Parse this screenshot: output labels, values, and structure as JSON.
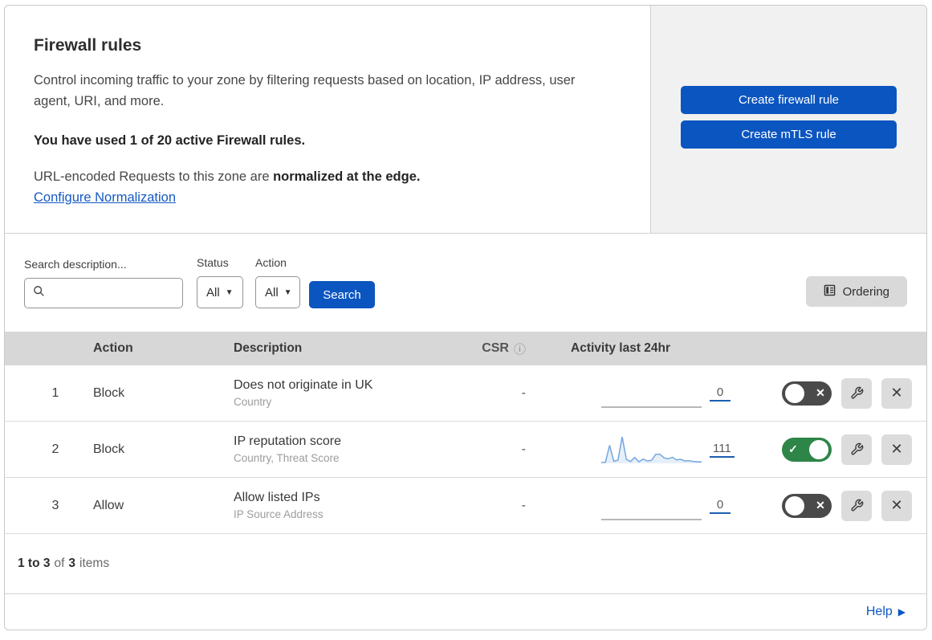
{
  "colors": {
    "accent_blue": "#0b55c0",
    "link_blue": "#1459c4",
    "toggle_on_green": "#2e8548",
    "toggle_off_gray": "#4a4a4a",
    "panel_gray": "#f1f1f1",
    "table_header_gray": "#d7d7d7",
    "icon_button_gray": "#dcdcdc",
    "sparkline_blue": "#74a7dd"
  },
  "header": {
    "title": "Firewall rules",
    "description": "Control incoming traffic to your zone by filtering requests based on location, IP address, user agent, URI, and more.",
    "usage_bold": "You have used 1 of 20 active Firewall rules.",
    "normalization_prefix": "URL-encoded Requests to this zone are ",
    "normalization_bold": "normalized at the edge.",
    "normalization_link": "Configure Normalization",
    "create_firewall_button": "Create firewall rule",
    "create_mtls_button": "Create mTLS rule"
  },
  "filters": {
    "search_label": "Search description...",
    "status_label": "Status",
    "status_value": "All",
    "action_label": "Action",
    "action_value": "All",
    "search_button": "Search",
    "ordering_button": "Ordering"
  },
  "table": {
    "columns": {
      "action": "Action",
      "description": "Description",
      "csr": "CSR",
      "activity": "Activity last 24hr"
    },
    "rows": [
      {
        "priority": "1",
        "action": "Block",
        "description": "Does not originate in UK",
        "fields": "Country",
        "csr": "-",
        "activity_count": "0",
        "enabled": false,
        "sparkline": []
      },
      {
        "priority": "2",
        "action": "Block",
        "description": "IP reputation score",
        "fields": "Country, Threat Score",
        "csr": "-",
        "activity_count": "111",
        "enabled": true,
        "sparkline": [
          0.3,
          0.4,
          6.8,
          0.8,
          1.2,
          10,
          1.5,
          0.7,
          2.2,
          0.6,
          1.6,
          0.9,
          1.1,
          3.4,
          3.5,
          2.1,
          1.7,
          2.3,
          1.3,
          1.5,
          0.9,
          1.0,
          0.7,
          0.6,
          0.5
        ]
      },
      {
        "priority": "3",
        "action": "Allow",
        "description": "Allow listed IPs",
        "fields": "IP Source Address",
        "csr": "-",
        "activity_count": "0",
        "enabled": false,
        "sparkline": []
      }
    ],
    "summary": {
      "range_bold": "1 to 3",
      "of": "of",
      "total_bold": "3",
      "items": "items"
    }
  },
  "footer": {
    "help": "Help"
  }
}
